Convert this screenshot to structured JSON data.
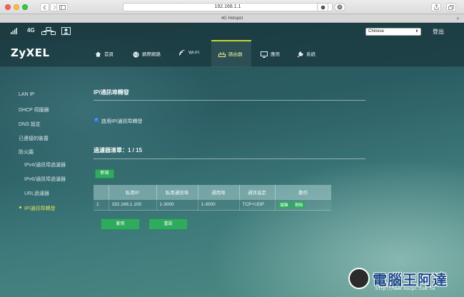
{
  "browser": {
    "url": "192.168.1.1",
    "tab_title": "4G Hotspot",
    "reload_glyph": "↻",
    "tab_plus": "+"
  },
  "status": {
    "network": "4G",
    "language": "Chinese",
    "logout": "登出"
  },
  "logo": "ZyXEL",
  "nav": [
    {
      "label": "首頁",
      "icon": "home-icon"
    },
    {
      "label": "網際網路",
      "icon": "globe-icon"
    },
    {
      "label": "Wi-Fi",
      "icon": "wifi-icon"
    },
    {
      "label": "路由器",
      "icon": "router-icon"
    },
    {
      "label": "應用",
      "icon": "monitor-icon"
    },
    {
      "label": "系統",
      "icon": "wrench-icon"
    }
  ],
  "sidebar": [
    {
      "label": "LAN IP"
    },
    {
      "label": "DHCP 伺服器"
    },
    {
      "label": "DNS 設定"
    },
    {
      "label": "已連接的裝置"
    },
    {
      "label": "防火牆"
    },
    {
      "label": "IPv4/通訊埠過濾器"
    },
    {
      "label": "IPv6/通訊埠過濾器"
    },
    {
      "label": "URL過濾器"
    },
    {
      "label": "IP/通訊埠轉發"
    }
  ],
  "main": {
    "title": "IP/通訊埠轉發",
    "enable_label": "啟用IP/通訊埠轉發",
    "list_title": "過濾器清單：1 / 15",
    "add_button": "新增",
    "table": {
      "headers": [
        "",
        "私用IP",
        "私用通訊埠",
        "通用埠",
        "通訊協定",
        "動作"
      ],
      "rows": [
        {
          "index": "1",
          "ip": "192.168.1.100",
          "private_port": "1-3000",
          "public_port": "1-3000",
          "protocol": "TCP+UDP"
        }
      ],
      "edit": "編輯",
      "delete": "刪除"
    },
    "apply_button": "套用",
    "reset_button": "重設"
  },
  "watermark": {
    "text": "電腦王阿達",
    "url": "http://www.kocpc.com.tw"
  }
}
